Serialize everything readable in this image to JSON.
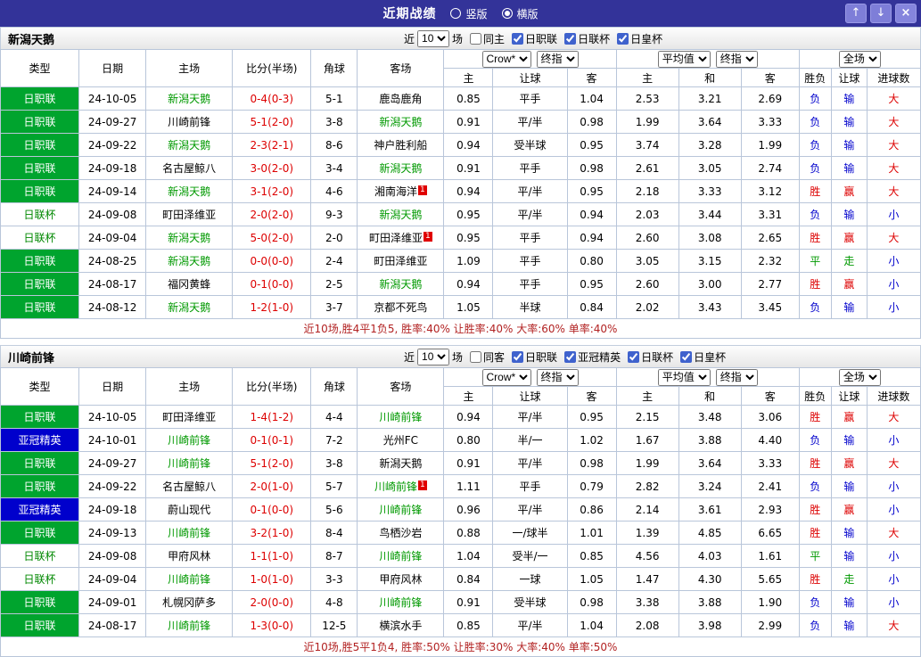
{
  "colors": {
    "titlebar_bg": "#333399",
    "titlebar_button": "#7e7ed8",
    "green_badge": "#00a42e",
    "blue_badge": "#0000cc",
    "cup_badge_text": "#008800",
    "team_highlight": "#009900",
    "score_red": "#dd0000",
    "result_red": "#dd0000",
    "result_blue": "#0000cc",
    "result_green": "#009900",
    "summary_text": "#b22222",
    "grid_border": "#b9c6da"
  },
  "titlebar": {
    "title": "近期战绩",
    "view_options": [
      {
        "label": "竖版",
        "selected": false
      },
      {
        "label": "横版",
        "selected": true
      }
    ],
    "buttons": {
      "up": "↑",
      "down": "↓",
      "close": "×"
    }
  },
  "filter_labels": {
    "near": "近",
    "matches": "场"
  },
  "table_header": {
    "left_columns": [
      "类型",
      "日期",
      "主场",
      "比分(半场)",
      "角球",
      "客场"
    ],
    "odds_selects": [
      "Crow*",
      "终指"
    ],
    "odds_columns": [
      "主",
      "让球",
      "客"
    ],
    "avg_selects": [
      "平均值",
      "终指"
    ],
    "avg_columns": [
      "主",
      "和",
      "客"
    ],
    "full_select": "全场",
    "full_columns": [
      "胜负",
      "让球",
      "进球数"
    ]
  },
  "teams": [
    {
      "name": "新潟天鹅",
      "filters": {
        "count": "10",
        "same_side": {
          "label": "同主",
          "checked": false
        },
        "competitions": [
          {
            "label": "日职联",
            "checked": true
          },
          {
            "label": "日联杯",
            "checked": true
          },
          {
            "label": "日皇杯",
            "checked": true
          }
        ]
      },
      "rows": [
        {
          "type": "日职联",
          "date": "24-10-05",
          "home": "新潟天鹅",
          "home_hl": true,
          "home_card": false,
          "score": "0-4(0-3)",
          "corner": "5-1",
          "away": "鹿岛鹿角",
          "away_hl": false,
          "away_card": false,
          "odds": [
            "0.85",
            "平手",
            "1.04"
          ],
          "avg": [
            "2.53",
            "3.21",
            "2.69"
          ],
          "results": [
            "负",
            "输",
            "大"
          ]
        },
        {
          "type": "日职联",
          "date": "24-09-27",
          "home": "川崎前锋",
          "home_hl": false,
          "home_card": false,
          "score": "5-1(2-0)",
          "corner": "3-8",
          "away": "新潟天鹅",
          "away_hl": true,
          "away_card": false,
          "odds": [
            "0.91",
            "平/半",
            "0.98"
          ],
          "avg": [
            "1.99",
            "3.64",
            "3.33"
          ],
          "results": [
            "负",
            "输",
            "大"
          ]
        },
        {
          "type": "日职联",
          "date": "24-09-22",
          "home": "新潟天鹅",
          "home_hl": true,
          "home_card": false,
          "score": "2-3(2-1)",
          "corner": "8-6",
          "away": "神户胜利船",
          "away_hl": false,
          "away_card": false,
          "odds": [
            "0.94",
            "受半球",
            "0.95"
          ],
          "avg": [
            "3.74",
            "3.28",
            "1.99"
          ],
          "results": [
            "负",
            "输",
            "大"
          ]
        },
        {
          "type": "日职联",
          "date": "24-09-18",
          "home": "名古屋鲸八",
          "home_hl": false,
          "home_card": false,
          "score": "3-0(2-0)",
          "corner": "3-4",
          "away": "新潟天鹅",
          "away_hl": true,
          "away_card": false,
          "odds": [
            "0.91",
            "平手",
            "0.98"
          ],
          "avg": [
            "2.61",
            "3.05",
            "2.74"
          ],
          "results": [
            "负",
            "输",
            "大"
          ]
        },
        {
          "type": "日职联",
          "date": "24-09-14",
          "home": "新潟天鹅",
          "home_hl": true,
          "home_card": false,
          "score": "3-1(2-0)",
          "corner": "4-6",
          "away": "湘南海洋",
          "away_hl": false,
          "away_card": true,
          "odds": [
            "0.94",
            "平/半",
            "0.95"
          ],
          "avg": [
            "2.18",
            "3.33",
            "3.12"
          ],
          "results": [
            "胜",
            "赢",
            "大"
          ]
        },
        {
          "type": "日联杯",
          "date": "24-09-08",
          "home": "町田泽维亚",
          "home_hl": false,
          "home_card": false,
          "score": "2-0(2-0)",
          "corner": "9-3",
          "away": "新潟天鹅",
          "away_hl": true,
          "away_card": false,
          "odds": [
            "0.95",
            "平/半",
            "0.94"
          ],
          "avg": [
            "2.03",
            "3.44",
            "3.31"
          ],
          "results": [
            "负",
            "输",
            "小"
          ]
        },
        {
          "type": "日联杯",
          "date": "24-09-04",
          "home": "新潟天鹅",
          "home_hl": true,
          "home_card": false,
          "score": "5-0(2-0)",
          "corner": "2-0",
          "away": "町田泽维亚",
          "away_hl": false,
          "away_card": true,
          "odds": [
            "0.95",
            "平手",
            "0.94"
          ],
          "avg": [
            "2.60",
            "3.08",
            "2.65"
          ],
          "results": [
            "胜",
            "赢",
            "大"
          ]
        },
        {
          "type": "日职联",
          "date": "24-08-25",
          "home": "新潟天鹅",
          "home_hl": true,
          "home_card": false,
          "score": "0-0(0-0)",
          "corner": "2-4",
          "away": "町田泽维亚",
          "away_hl": false,
          "away_card": false,
          "odds": [
            "1.09",
            "平手",
            "0.80"
          ],
          "avg": [
            "3.05",
            "3.15",
            "2.32"
          ],
          "results": [
            "平",
            "走",
            "小"
          ]
        },
        {
          "type": "日职联",
          "date": "24-08-17",
          "home": "福冈黄蜂",
          "home_hl": false,
          "home_card": false,
          "score": "0-1(0-0)",
          "corner": "2-5",
          "away": "新潟天鹅",
          "away_hl": true,
          "away_card": false,
          "odds": [
            "0.94",
            "平手",
            "0.95"
          ],
          "avg": [
            "2.60",
            "3.00",
            "2.77"
          ],
          "results": [
            "胜",
            "赢",
            "小"
          ]
        },
        {
          "type": "日职联",
          "date": "24-08-12",
          "home": "新潟天鹅",
          "home_hl": true,
          "home_card": false,
          "score": "1-2(1-0)",
          "corner": "3-7",
          "away": "京都不死鸟",
          "away_hl": false,
          "away_card": false,
          "odds": [
            "1.05",
            "半球",
            "0.84"
          ],
          "avg": [
            "2.02",
            "3.43",
            "3.45"
          ],
          "results": [
            "负",
            "输",
            "小"
          ]
        }
      ],
      "summary": "近10场,胜4平1负5, 胜率:40% 让胜率:40% 大率:60% 单率:40%"
    },
    {
      "name": "川崎前锋",
      "filters": {
        "count": "10",
        "same_side": {
          "label": "同客",
          "checked": false
        },
        "competitions": [
          {
            "label": "日职联",
            "checked": true
          },
          {
            "label": "亚冠精英",
            "checked": true
          },
          {
            "label": "日联杯",
            "checked": true
          },
          {
            "label": "日皇杯",
            "checked": true
          }
        ]
      },
      "rows": [
        {
          "type": "日职联",
          "date": "24-10-05",
          "home": "町田泽维亚",
          "home_hl": false,
          "home_card": false,
          "score": "1-4(1-2)",
          "corner": "4-4",
          "away": "川崎前锋",
          "away_hl": true,
          "away_card": false,
          "odds": [
            "0.94",
            "平/半",
            "0.95"
          ],
          "avg": [
            "2.15",
            "3.48",
            "3.06"
          ],
          "results": [
            "胜",
            "赢",
            "大"
          ]
        },
        {
          "type": "亚冠精英",
          "date": "24-10-01",
          "home": "川崎前锋",
          "home_hl": true,
          "home_card": false,
          "score": "0-1(0-1)",
          "corner": "7-2",
          "away": "光州FC",
          "away_hl": false,
          "away_card": false,
          "odds": [
            "0.80",
            "半/一",
            "1.02"
          ],
          "avg": [
            "1.67",
            "3.88",
            "4.40"
          ],
          "results": [
            "负",
            "输",
            "小"
          ]
        },
        {
          "type": "日职联",
          "date": "24-09-27",
          "home": "川崎前锋",
          "home_hl": true,
          "home_card": false,
          "score": "5-1(2-0)",
          "corner": "3-8",
          "away": "新潟天鹅",
          "away_hl": false,
          "away_card": false,
          "odds": [
            "0.91",
            "平/半",
            "0.98"
          ],
          "avg": [
            "1.99",
            "3.64",
            "3.33"
          ],
          "results": [
            "胜",
            "赢",
            "大"
          ]
        },
        {
          "type": "日职联",
          "date": "24-09-22",
          "home": "名古屋鲸八",
          "home_hl": false,
          "home_card": false,
          "score": "2-0(1-0)",
          "corner": "5-7",
          "away": "川崎前锋",
          "away_hl": true,
          "away_card": true,
          "odds": [
            "1.11",
            "平手",
            "0.79"
          ],
          "avg": [
            "2.82",
            "3.24",
            "2.41"
          ],
          "results": [
            "负",
            "输",
            "小"
          ]
        },
        {
          "type": "亚冠精英",
          "date": "24-09-18",
          "home": "蔚山现代",
          "home_hl": false,
          "home_card": false,
          "score": "0-1(0-0)",
          "corner": "5-6",
          "away": "川崎前锋",
          "away_hl": true,
          "away_card": false,
          "odds": [
            "0.96",
            "平/半",
            "0.86"
          ],
          "avg": [
            "2.14",
            "3.61",
            "2.93"
          ],
          "results": [
            "胜",
            "赢",
            "小"
          ]
        },
        {
          "type": "日职联",
          "date": "24-09-13",
          "home": "川崎前锋",
          "home_hl": true,
          "home_card": false,
          "score": "3-2(1-0)",
          "corner": "8-4",
          "away": "鸟栖沙岩",
          "away_hl": false,
          "away_card": false,
          "odds": [
            "0.88",
            "一/球半",
            "1.01"
          ],
          "avg": [
            "1.39",
            "4.85",
            "6.65"
          ],
          "results": [
            "胜",
            "输",
            "大"
          ]
        },
        {
          "type": "日联杯",
          "date": "24-09-08",
          "home": "甲府风林",
          "home_hl": false,
          "home_card": false,
          "score": "1-1(1-0)",
          "corner": "8-7",
          "away": "川崎前锋",
          "away_hl": true,
          "away_card": false,
          "odds": [
            "1.04",
            "受半/一",
            "0.85"
          ],
          "avg": [
            "4.56",
            "4.03",
            "1.61"
          ],
          "results": [
            "平",
            "输",
            "小"
          ]
        },
        {
          "type": "日联杯",
          "date": "24-09-04",
          "home": "川崎前锋",
          "home_hl": true,
          "home_card": false,
          "score": "1-0(1-0)",
          "corner": "3-3",
          "away": "甲府风林",
          "away_hl": false,
          "away_card": false,
          "odds": [
            "0.84",
            "一球",
            "1.05"
          ],
          "avg": [
            "1.47",
            "4.30",
            "5.65"
          ],
          "results": [
            "胜",
            "走",
            "小"
          ]
        },
        {
          "type": "日职联",
          "date": "24-09-01",
          "home": "札幌冈萨多",
          "home_hl": false,
          "home_card": false,
          "score": "2-0(0-0)",
          "corner": "4-8",
          "away": "川崎前锋",
          "away_hl": true,
          "away_card": false,
          "odds": [
            "0.91",
            "受半球",
            "0.98"
          ],
          "avg": [
            "3.38",
            "3.88",
            "1.90"
          ],
          "results": [
            "负",
            "输",
            "小"
          ]
        },
        {
          "type": "日职联",
          "date": "24-08-17",
          "home": "川崎前锋",
          "home_hl": true,
          "home_card": false,
          "score": "1-3(0-0)",
          "corner": "12-5",
          "away": "横滨水手",
          "away_hl": false,
          "away_card": false,
          "odds": [
            "0.85",
            "平/半",
            "1.04"
          ],
          "avg": [
            "2.08",
            "3.98",
            "2.99"
          ],
          "results": [
            "负",
            "输",
            "大"
          ]
        }
      ],
      "summary": "近10场,胜5平1负4, 胜率:50% 让胜率:30% 大率:40% 单率:50%"
    }
  ]
}
